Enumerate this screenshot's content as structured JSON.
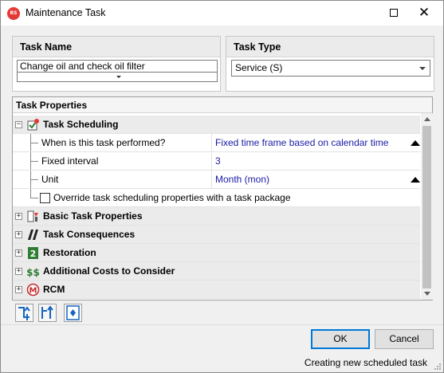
{
  "window": {
    "title": "Maintenance Task",
    "logo_text": "RS",
    "close_glyph": "✕"
  },
  "task_name": {
    "header": "Task Name",
    "value": "Change oil and check oil filter"
  },
  "task_type": {
    "header": "Task Type",
    "selected": "Service (S)"
  },
  "properties": {
    "header": "Task Properties",
    "scheduling": {
      "label": "Task Scheduling",
      "expander": "−",
      "rows": [
        {
          "name": "When is this task performed?",
          "value": "Fixed time frame based on calendar time"
        },
        {
          "name": "Fixed interval",
          "value": "3"
        },
        {
          "name": "Unit",
          "value": "Month (mon)"
        }
      ],
      "override_label": "Override task scheduling properties with a task package",
      "override_checked": false
    },
    "categories": [
      {
        "label": "Basic Task Properties",
        "expander": "+",
        "icon": "basic-properties-icon"
      },
      {
        "label": "Task Consequences",
        "expander": "+",
        "icon": "consequences-icon"
      },
      {
        "label": "Restoration",
        "expander": "+",
        "icon": "restoration-icon",
        "icon_text": "2"
      },
      {
        "label": "Additional Costs to Consider",
        "expander": "+",
        "icon": "costs-icon",
        "icon_text": "$$"
      },
      {
        "label": "RCM",
        "expander": "+",
        "icon": "rcm-icon",
        "icon_text": "M"
      }
    ]
  },
  "toolbar": {
    "buttons": [
      "collapse-all-icon",
      "expand-all-icon",
      "toggle-description-icon"
    ]
  },
  "buttons": {
    "ok": "OK",
    "cancel": "Cancel"
  },
  "status": "Creating new scheduled task",
  "colors": {
    "value_text": "#1a1aa6",
    "accent": "#0078d7",
    "logo": "#e53935"
  }
}
